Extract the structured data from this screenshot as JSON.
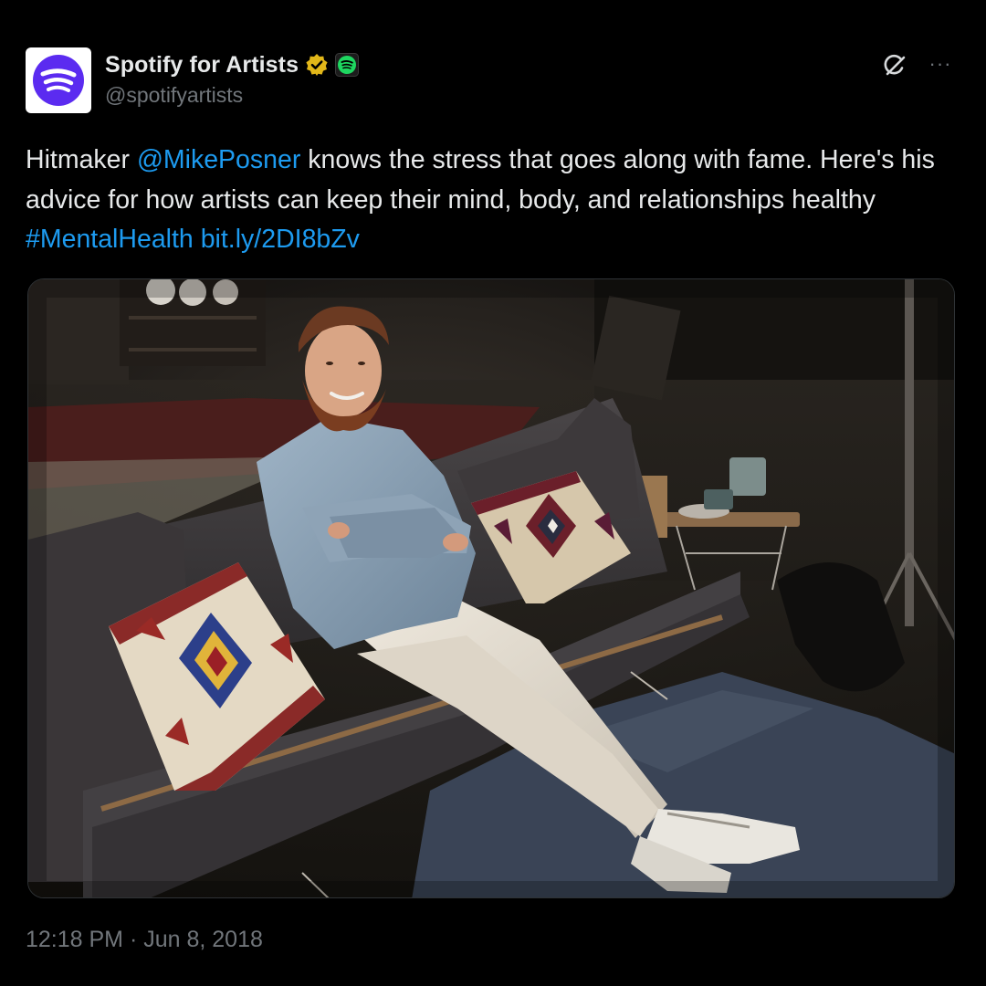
{
  "author": {
    "display_name": "Spotify for Artists",
    "handle": "@spotifyartists",
    "verified_icon": "gold-verified-badge-icon",
    "affiliate_icon": "spotify-logo-icon",
    "avatar_color": "#5b2bf0"
  },
  "actions": {
    "grok_icon": "grok-icon",
    "more_label": "···"
  },
  "text": {
    "part1": "Hitmaker ",
    "mention": "@MikePosner",
    "part2": " knows the stress that goes along with fame. Here's his advice for how artists can keep their mind, body, and relationships healthy ",
    "hashtag": "#MentalHealth",
    "space": " ",
    "url": "bit.ly/2DI8bZv"
  },
  "media": {
    "kind": "photo",
    "subject": "man-on-sofa-photo"
  },
  "timestamp": "12:18 PM · Jun 8, 2018",
  "colors": {
    "background": "#000000",
    "text": "#e7e9ea",
    "muted": "#71767b",
    "link": "#1d9bf0",
    "verified_gold": "#e2b719",
    "spotify_green": "#1ed760"
  }
}
